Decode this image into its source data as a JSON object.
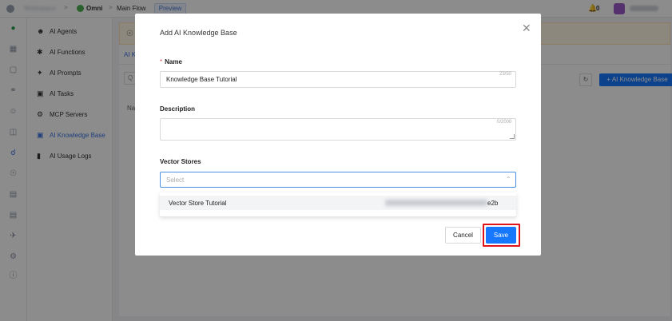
{
  "header": {
    "breadcrumb_omni": "Omni",
    "breadcrumb_flow": "Main Flow",
    "preview_tag": "Preview",
    "notification_count": "0"
  },
  "nav": {
    "items": [
      {
        "label": "AI Agents",
        "icon": "person-icon"
      },
      {
        "label": "AI Functions",
        "icon": "puzzle-icon"
      },
      {
        "label": "AI Prompts",
        "icon": "magic-wand-icon"
      },
      {
        "label": "AI Tasks",
        "icon": "clipboard-icon"
      },
      {
        "label": "MCP Servers",
        "icon": "server-icon"
      },
      {
        "label": "AI Knowledge Base",
        "icon": "book-icon",
        "active": true
      },
      {
        "label": "AI Usage Logs",
        "icon": "bar-chart-icon"
      }
    ]
  },
  "main": {
    "tab_label": "AI K",
    "column_header": "Na",
    "add_button": "+ AI Knowledge Base"
  },
  "modal": {
    "title": "Add AI Knowledge Base",
    "name_label": "Name",
    "name_value": "Knowledge Base Tutorial",
    "name_counter": "23/50",
    "description_label": "Description",
    "description_value": "",
    "description_counter": "0/2000",
    "vector_stores_label": "Vector Stores",
    "vector_stores_placeholder": "Select",
    "dropdown_option_name": "Vector Store Tutorial",
    "dropdown_option_id_suffix": "e2b",
    "cancel_label": "Cancel",
    "save_label": "Save"
  },
  "colors": {
    "primary": "#1677ff",
    "highlight": "#e0131b",
    "active_nav": "#3b73e0"
  }
}
